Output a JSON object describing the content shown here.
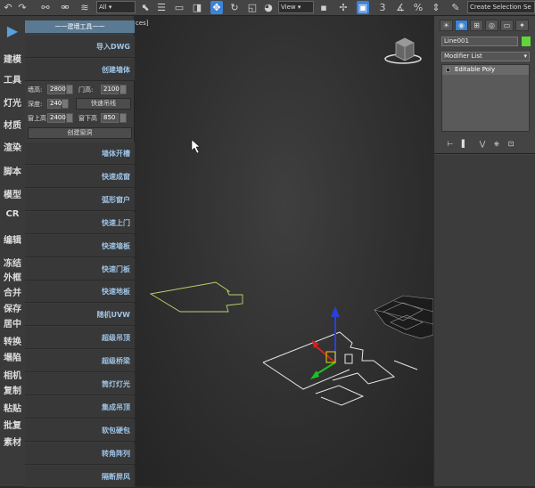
{
  "toolbar": {
    "undo_icon": "undo-icon",
    "redo_icon": "redo-icon",
    "selection_filter": "All",
    "viewport_label_cut": "ces]",
    "ref_coord": "View",
    "named_selection": "Create Selection Se"
  },
  "categories": [
    "建模",
    "工具",
    "灯光",
    "材质",
    "渲染",
    "脚本",
    "模型",
    "CR",
    "编辑",
    "冻结",
    "外框",
    "合并",
    "保存",
    "居中",
    "转换",
    "塌陷",
    "相机",
    "复制",
    "粘贴",
    "批复",
    "素材"
  ],
  "panel": {
    "title": "一一建墙工具一一",
    "import_dwg": "导入DWG",
    "create_wall": "创建墙体",
    "wall_height_label": "墙高:",
    "wall_height_value": "2800",
    "door_height_label": "门高:",
    "door_height_value": "2100",
    "depth_label": "深度:",
    "depth_value": "240",
    "quick_line_button": "快速吊线",
    "window_sill_label": "窗上高",
    "window_sill_value": "2400",
    "window_bottom_label": "窗下高",
    "window_bottom_value": "850",
    "create_hole_button": "创建窗洞",
    "tools": [
      "墙体开槽",
      "快速成窗",
      "弧形窗户",
      "快速上门",
      "快速墙板",
      "快速门板",
      "快速地板",
      "随机UVW",
      "超级吊顶",
      "超级桥梁",
      "筒灯灯光",
      "集成吊顶",
      "软包硬包",
      "转角阵列",
      "隔断屏风"
    ]
  },
  "command_panel": {
    "object_name": "Line001",
    "object_color": "#5fd63a",
    "modifier_list": "Modifier List",
    "modifier_stack": [
      "Editable Poly"
    ]
  },
  "colors": {
    "accent_blue": "#3b83d6",
    "panel_title_bg": "#5a7a93",
    "tool_text": "#9ec4e6",
    "selected_shape": "#b7d36b"
  }
}
